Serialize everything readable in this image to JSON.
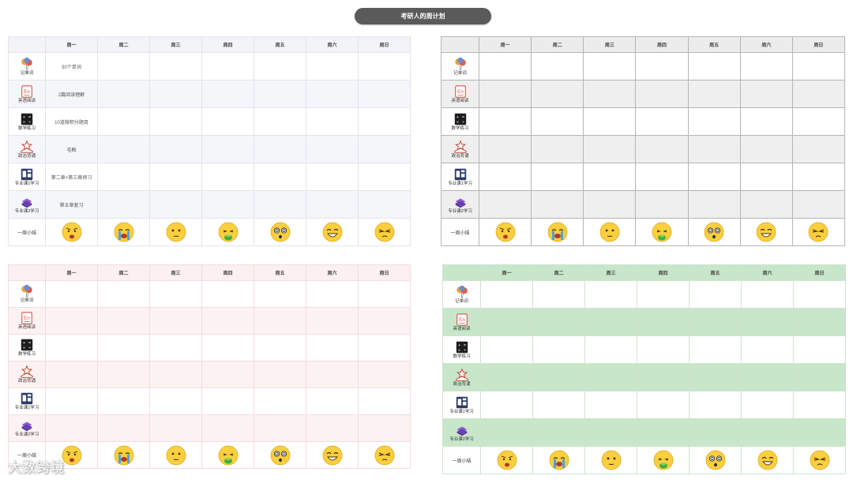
{
  "page_title": "考研人的周计划",
  "days": [
    "周一",
    "周二",
    "周三",
    "周四",
    "周五",
    "周六",
    "周日"
  ],
  "subjects": [
    "记单词",
    "英语阅读",
    "数学练习",
    "政治背诵",
    "专业课1学习",
    "专业课2学习"
  ],
  "subject_icons": [
    "balloons-icon",
    "english-en-icon",
    "math-calculator-icon",
    "politics-book-star-icon",
    "study-screen-icon",
    "books-stack-icon"
  ],
  "summary_label": "一周小结",
  "mood_icons": [
    "angry-face-icon",
    "crying-face-icon",
    "neutral-face-icon",
    "nauseated-face-icon",
    "dizzy-face-icon",
    "grinning-face-icon",
    "unamused-face-icon"
  ],
  "tasks_monday": [
    "50个单词",
    "2篇阅读理解",
    "10道微积分题目",
    "毛概",
    "第二章+第三章预习",
    "第五章复习"
  ],
  "watermark": "大数跨境",
  "theme_colors": {
    "title_bg": "#5a5a5a",
    "gray_alt": "#efefef",
    "pink_alt": "#fdf2f2",
    "green_alt": "#c8e6c9"
  }
}
